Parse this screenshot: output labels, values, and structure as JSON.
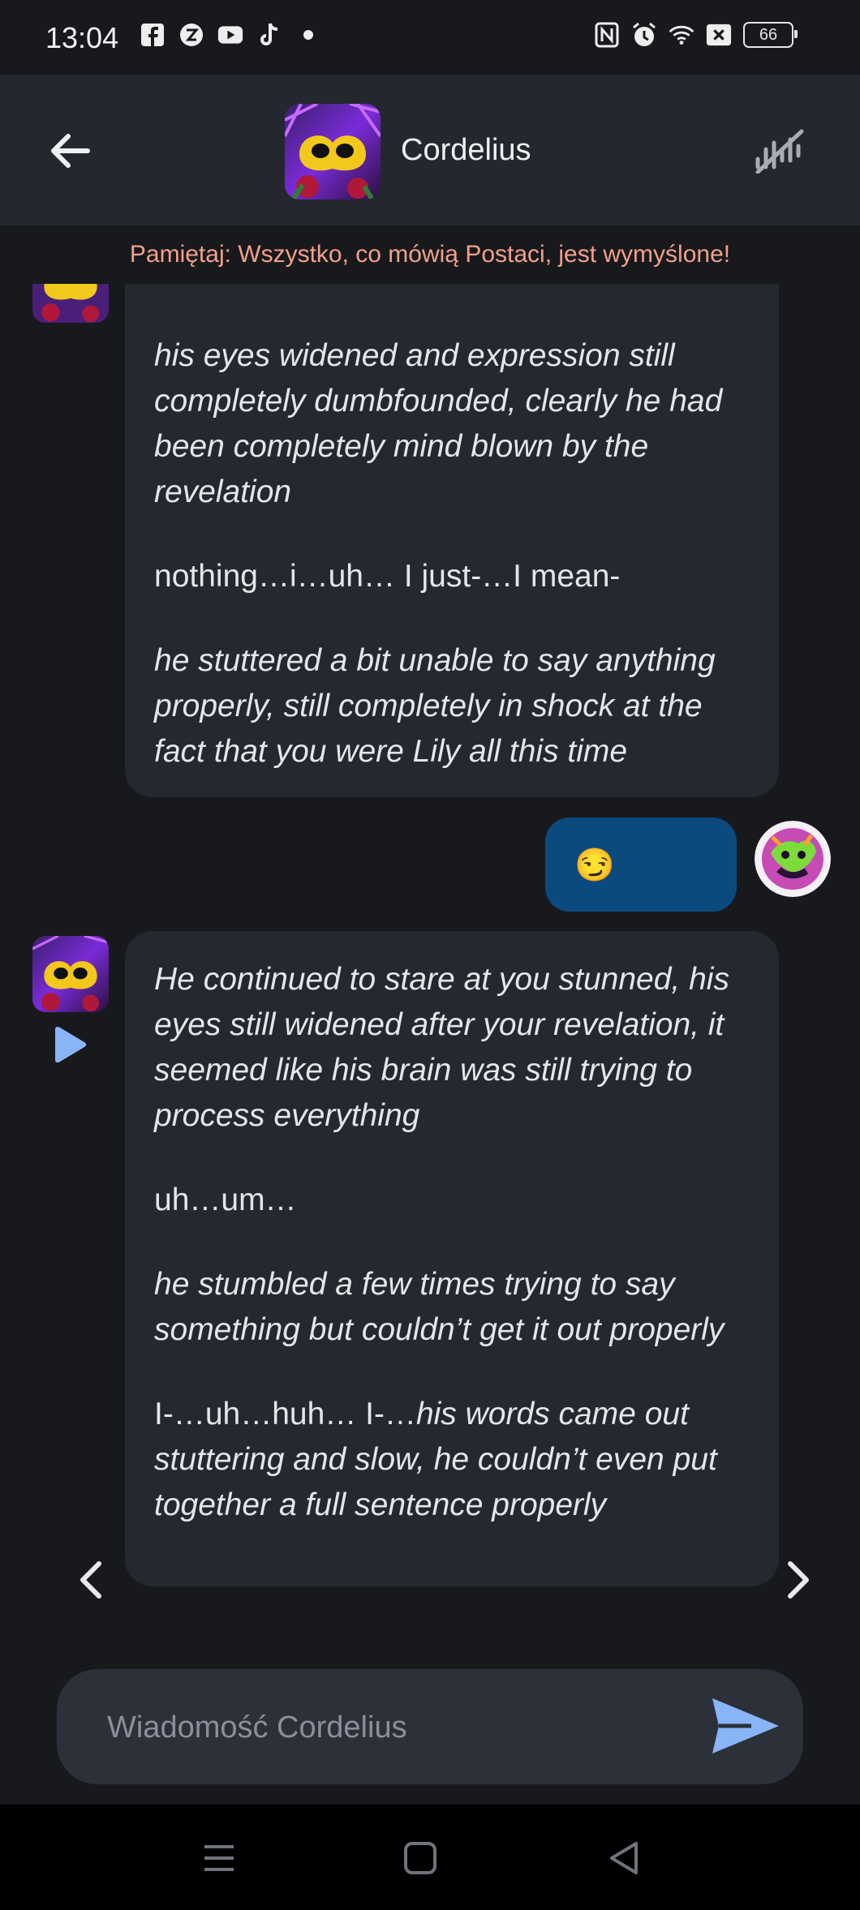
{
  "status_bar": {
    "time": "13:04",
    "battery": "66",
    "left_icons": [
      "facebook-icon",
      "z-app-icon",
      "youtube-icon",
      "tiktok-icon",
      "dot-icon"
    ],
    "right_icons": [
      "nfc-icon",
      "alarm-icon",
      "wifi-icon",
      "sim-off-icon",
      "battery-icon"
    ]
  },
  "header": {
    "character_name": "Cordelius"
  },
  "disclaimer": "Pamiętaj: Wszystko, co mówią Postaci, jest wymyślone!",
  "messages": [
    {
      "sender": "character",
      "paragraphs": [
        {
          "text": "his eyes widened and expression still completely dumbfounded, clearly he had been completely mind blown by the revelation",
          "italic": true
        },
        {
          "text": "nothing…i…uh… I just-…I mean-",
          "italic": false
        },
        {
          "text": "he stuttered a bit unable to say anything properly, still completely in shock at the fact that you were Lily all this time",
          "italic": true
        }
      ]
    },
    {
      "sender": "user",
      "text": "😏"
    },
    {
      "sender": "character",
      "paragraphs": [
        {
          "text": "He continued to stare at you stunned, his eyes still widened after your revelation, it seemed like his brain was still trying to process everything",
          "italic": true
        },
        {
          "text": "uh…um…",
          "italic": false
        },
        {
          "text": "he stumbled a few times trying to say something but couldn’t get it out properly",
          "italic": true
        },
        {
          "normal": "I-…uh…huh… I-…",
          "italic_part": "his words came out stuttering and slow, he couldn’t even put together a full sentence properly"
        }
      ]
    }
  ],
  "input": {
    "placeholder": "Wiadomość Cordelius"
  },
  "colors": {
    "background": "#18191d",
    "header": "#24272d",
    "bubble_character": "#25282e",
    "bubble_user": "#0b4a7f",
    "disclaimer": "#f3a089",
    "accent": "#8ab4f8"
  }
}
